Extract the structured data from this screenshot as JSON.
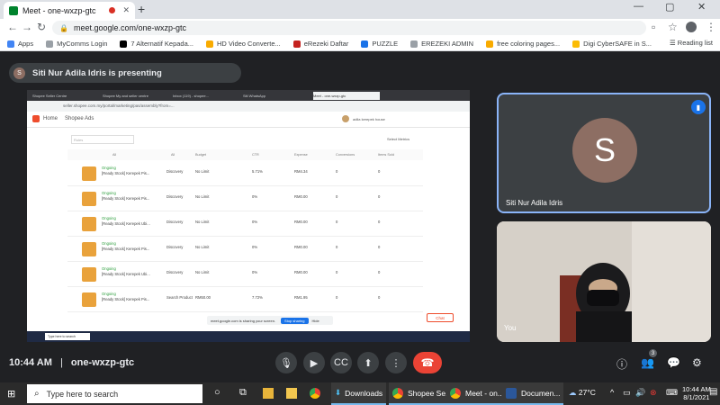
{
  "browser": {
    "tab_title": "Meet - one-wxzp-gtc",
    "url": "meet.google.com/one-wxzp-gtc",
    "bookmarks": [
      {
        "label": "Apps",
        "color": "#4285f4"
      },
      {
        "label": "MyComms Login",
        "color": "#9aa0a6"
      },
      {
        "label": "7 Alternatif Kepada...",
        "color": "#000000"
      },
      {
        "label": "HD Video Converte...",
        "color": "#f9ab00"
      },
      {
        "label": "eRezeki Daftar",
        "color": "#c5221f"
      },
      {
        "label": "PUZZLE",
        "color": "#1a73e8"
      },
      {
        "label": "EREZEKI ADMIN",
        "color": "#9aa0a6"
      },
      {
        "label": "free coloring pages...",
        "color": "#f9ab00"
      },
      {
        "label": "Digi CyberSAFE in S...",
        "color": "#fbbc04"
      }
    ],
    "reading_list": "Reading list"
  },
  "meet": {
    "presenting_banner": "Siti Nur Adila Idris is presenting",
    "presenter_initial": "S",
    "participant_name": "Siti Nur Adila Idris",
    "self_label": "You",
    "time": "10:44 AM",
    "meeting_code": "one-wxzp-gtc",
    "people_count": "3"
  },
  "shared_screen": {
    "inner_tabs": [
      "Shopee Seller Centre",
      "Shopee My and seller centre",
      "Inbox (119) - shopee...",
      "Siti WhatsApp",
      "Meet - one-wxzp-gtc"
    ],
    "inner_url": "seller.shopee.com.my/portal/marketing/pas/assembly?from=...",
    "breadcrumb_home": "Home",
    "breadcrumb_page": "Shopee Ads",
    "shop_name": "adila kerepek house",
    "select_metrics": "Select Metrics",
    "search_placeholder": "Rules",
    "headers": [
      "All",
      "All",
      "Budget",
      "CTR",
      "Expense",
      "Conversions",
      "Items Sold"
    ],
    "rows": [
      {
        "status": "Ongoing",
        "name": "[Ready Stock] Kerepek Pis...",
        "type": "Discovery",
        "budget": "No Limit",
        "ctr": "5.71%",
        "expense": "RM4.34",
        "conv": "0",
        "sold": "0"
      },
      {
        "status": "Ongoing",
        "name": "[Ready Stock] Kerepek Pis...",
        "type": "Discovery",
        "budget": "No Limit",
        "ctr": "0%",
        "expense": "RM0.00",
        "conv": "0",
        "sold": "0"
      },
      {
        "status": "Ongoing",
        "name": "[Ready Stock] Kerepek Ubi...",
        "type": "Discovery",
        "budget": "No Limit",
        "ctr": "0%",
        "expense": "RM0.00",
        "conv": "0",
        "sold": "0"
      },
      {
        "status": "Ongoing",
        "name": "[Ready Stock] Kerepek Pis...",
        "type": "Discovery",
        "budget": "No Limit",
        "ctr": "0%",
        "expense": "RM0.00",
        "conv": "0",
        "sold": "0"
      },
      {
        "status": "Ongoing",
        "name": "[Ready Stock] Kerepek Ubi...",
        "type": "Discovery",
        "budget": "No Limit",
        "ctr": "0%",
        "expense": "RM0.00",
        "conv": "0",
        "sold": "0"
      },
      {
        "status": "Ongoing",
        "name": "[Ready Stock] Kerepek Pis...",
        "type": "Search Product",
        "budget": "RM50.00",
        "ctr": "7.72%",
        "expense": "RM1.95",
        "conv": "0",
        "sold": "0"
      }
    ],
    "share_notice": "meet.google.com is sharing your screen.",
    "stop_sharing": "Stop sharing",
    "hide": "Hide",
    "chat": "Chat",
    "inner_search": "Type here to search"
  },
  "taskbar": {
    "search_placeholder": "Type here to search",
    "apps": [
      "Downloads",
      "Shopee Se...",
      "Meet - on...",
      "Documen..."
    ],
    "weather": "27°C",
    "time": "10:44 AM",
    "date": "8/1/2021"
  }
}
